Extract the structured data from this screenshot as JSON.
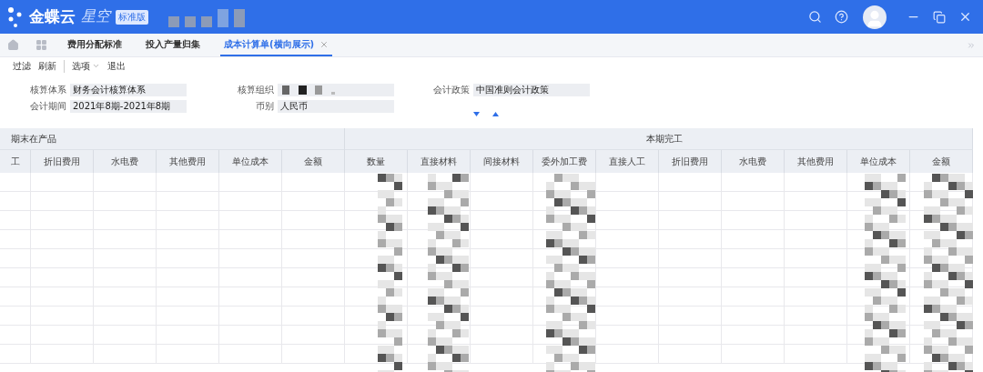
{
  "app": {
    "brand": "金蝶云",
    "product": "星空",
    "edition": "标准版"
  },
  "tabs": [
    {
      "label": "费用分配标准",
      "selected": false,
      "closable": false
    },
    {
      "label": "投入产量归集",
      "selected": false,
      "closable": false
    },
    {
      "label": "成本计算单(横向展示)",
      "selected": true,
      "closable": true
    }
  ],
  "toolbar": [
    {
      "label": "过滤",
      "dropdown": false,
      "divider_after": false
    },
    {
      "label": "刷新",
      "dropdown": false,
      "divider_after": true
    },
    {
      "label": "选项",
      "dropdown": true,
      "divider_after": false
    },
    {
      "label": "退出",
      "dropdown": false,
      "divider_after": false
    }
  ],
  "filters": [
    {
      "label": "核算体系",
      "value": "财务会计核算体系",
      "kind": "text"
    },
    {
      "label": "会计期间",
      "value": "2021年8期-2021年8期",
      "kind": "text"
    },
    {
      "label": "核算组织",
      "kind": "redacted"
    },
    {
      "label": "币别",
      "value": "人民币",
      "kind": "text"
    },
    {
      "label": "会计政策",
      "value": "中国准则会计政策",
      "kind": "text"
    }
  ],
  "table": {
    "groups": [
      {
        "label": "期末在产品",
        "columns": [
          "工",
          "折旧费用",
          "水电费",
          "其他费用",
          "单位成本",
          "金额"
        ]
      },
      {
        "label": "本期完工",
        "columns": [
          "数量",
          "直接材料",
          "间接材料",
          "委外加工费",
          "直接人工",
          "折旧费用",
          "水电费",
          "其他费用",
          "单位成本",
          "金额"
        ]
      }
    ]
  }
}
